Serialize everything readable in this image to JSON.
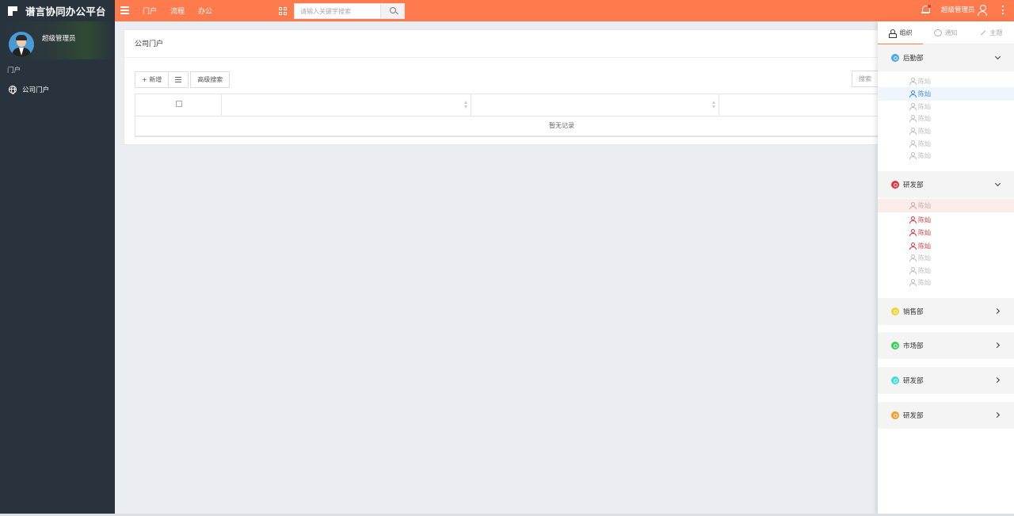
{
  "app": {
    "title": "谱言协同办公平台"
  },
  "topnav": {
    "items": [
      "门户",
      "流程",
      "办公"
    ],
    "search_placeholder": "请输入关键字搜索",
    "user_name": "超级管理员"
  },
  "sidebar": {
    "user_name": "超级管理员",
    "section_label": "门户",
    "nav_item": "公司门户"
  },
  "main": {
    "card_title": "公司门户",
    "toolbar": {
      "add_label": "+ 新增",
      "advanced_search_label": "高级搜索",
      "search_label": "搜索"
    },
    "table": {
      "empty_text": "暂无记录"
    }
  },
  "right_panel": {
    "tabs": [
      "组织",
      "通知",
      "主题"
    ],
    "departments": [
      {
        "name": "后勤部",
        "color": "#4aa8e8",
        "expanded": true,
        "members": [
          "陈灿",
          "陈灿",
          "陈灿",
          "陈灿",
          "陈灿",
          "陈灿",
          "陈灿"
        ]
      },
      {
        "name": "研发部",
        "color": "#e0353f",
        "expanded": true,
        "members": [
          "陈灿",
          "陈灿",
          "陈灿",
          "陈灿",
          "陈灿",
          "陈灿",
          "陈灿"
        ]
      },
      {
        "name": "销售部",
        "color": "#f2d22e",
        "expanded": false
      },
      {
        "name": "市场部",
        "color": "#3bd15b",
        "expanded": false
      },
      {
        "name": "研发部",
        "color": "#3de0d8",
        "expanded": false
      },
      {
        "name": "研发部",
        "color": "#f0a12e",
        "expanded": false
      }
    ]
  },
  "colors": {
    "topbar": "#ff7a4d",
    "sidebar": "#28333e",
    "accent_blue": "#3c8dde",
    "accent_red": "#d23a3a"
  }
}
